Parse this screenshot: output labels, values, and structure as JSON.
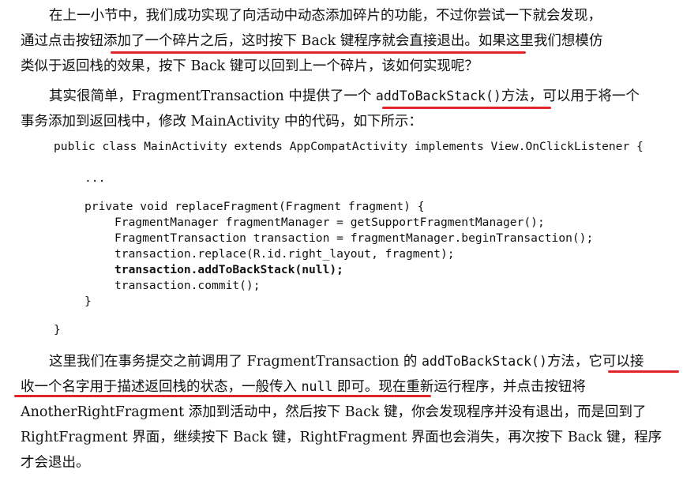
{
  "paragraph1": {
    "line1": "在上一小节中，我们成功实现了向活动中动态添加碎片的功能，不过你尝试一下就会发现，",
    "line2": "通过点击按钮添加了一个碎片之后，这时按下 Back 键程序就会直接退出。如果这里我们想模仿",
    "line3": "类似于返回栈的效果，按下 Back 键可以回到上一个碎片，该如何实现呢？"
  },
  "paragraph2": {
    "line1_pre": "其实很简单，FragmentTransaction 中提供了一个 ",
    "line1_code": "addToBackStack()",
    "line1_post": "方法，可以用于将一个",
    "line2": "事务添加到返回栈中，修改 MainActivity 中的代码，如下所示："
  },
  "code": {
    "l1": "public class MainActivity extends AppCompatActivity implements View.OnClickListener {",
    "l2": "...",
    "l3": "private void replaceFragment(Fragment fragment) {",
    "l4": "FragmentManager fragmentManager = getSupportFragmentManager();",
    "l5": "FragmentTransaction transaction = fragmentManager.beginTransaction();",
    "l6": "transaction.replace(R.id.right_layout, fragment);",
    "l7": "transaction.addToBackStack(null);",
    "l8": "transaction.commit();",
    "l9": "}",
    "l10": "}"
  },
  "paragraph3": {
    "line1_pre": "这里我们在事务提交之前调用了 FragmentTransaction 的 ",
    "line1_code": "addToBackStack()",
    "line1_post": "方法，它可以接",
    "line2_pre": "收一个名字用于描述返回栈的状态，一般传入 ",
    "line2_code": "null",
    "line2_post": " 即可。现在重新运行程序，并点击按钮将",
    "line3": "AnotherRightFragment 添加到活动中，然后按下 Back 键，你会发现程序并没有退出，而是回到了",
    "line4": "RightFragment 界面，继续按下 Back 键，RightFragment 界面也会消失，再次按下 Back 键，程序",
    "line5": "才会退出。"
  },
  "colors": {
    "text": "#111111",
    "annotation": "#e0242a"
  }
}
